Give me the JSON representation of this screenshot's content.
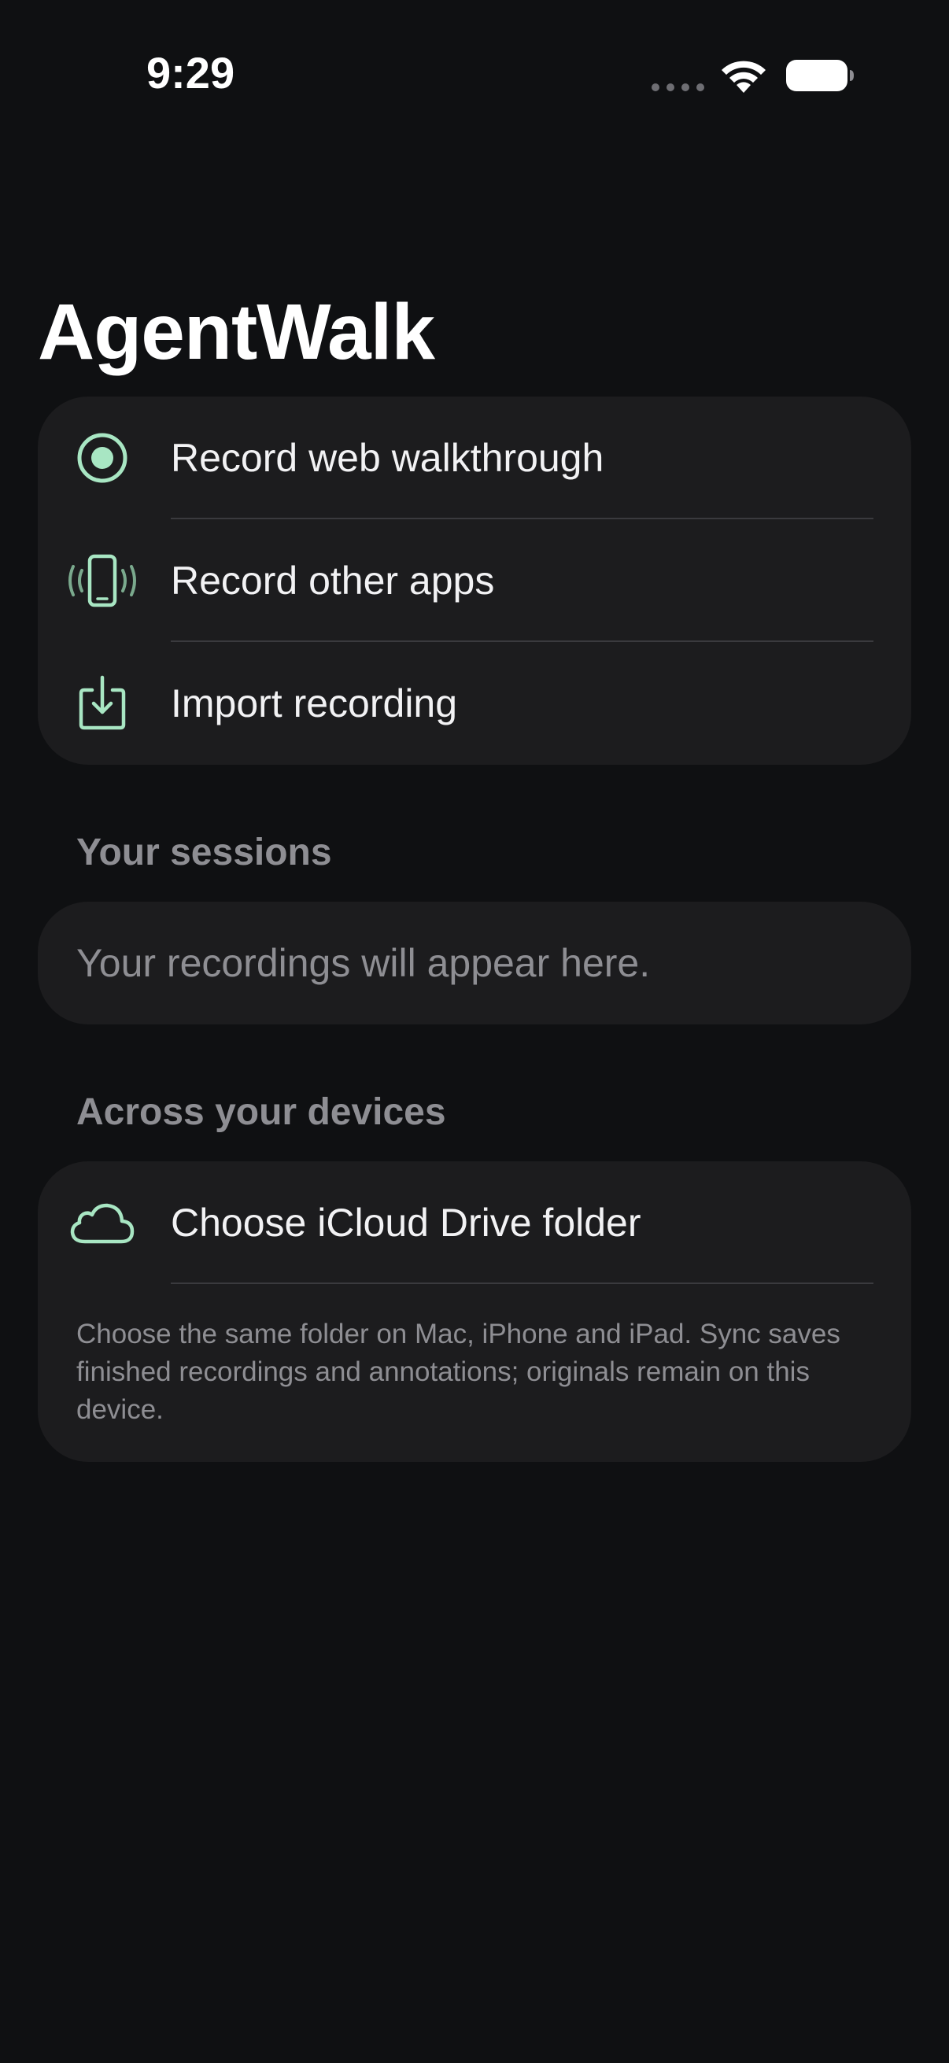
{
  "status_bar": {
    "time": "9:29",
    "icons": [
      "signal-dots-icon",
      "wifi-icon",
      "battery-icon"
    ]
  },
  "app": {
    "title": "AgentWalk",
    "accent_color": "#a8e6c3"
  },
  "actions": [
    {
      "icon": "record-icon",
      "label": "Record web walkthrough"
    },
    {
      "icon": "phone-vibrate-icon",
      "label": "Record other apps"
    },
    {
      "icon": "import-icon",
      "label": "Import recording"
    }
  ],
  "sessions": {
    "header": "Your sessions",
    "empty_text": "Your recordings will appear here."
  },
  "devices": {
    "header": "Across your devices",
    "choose_folder_icon": "cloud-icon",
    "choose_folder_label": "Choose iCloud Drive folder",
    "footnote": "Choose the same folder on Mac, iPhone and iPad. Sync saves finished recordings and annotations; originals remain on this device."
  }
}
